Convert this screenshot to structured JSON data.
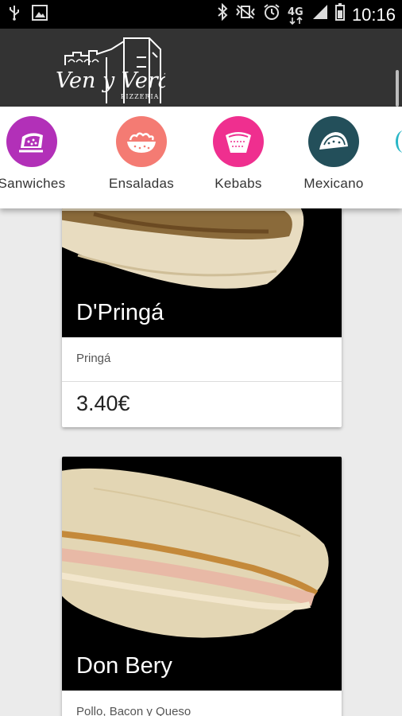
{
  "status_bar": {
    "left_icons": [
      "usb-icon",
      "image-icon"
    ],
    "right_icons": [
      "bluetooth-icon",
      "vibrate-off-icon",
      "alarm-icon",
      "network-4g-icon",
      "signal-icon",
      "battery-icon"
    ],
    "network_label": "4G",
    "time": "10:16"
  },
  "header": {
    "logo_text": "Ven y Verás",
    "logo_subtext": "PIZZERIA"
  },
  "categories": [
    {
      "label": "Sanwiches",
      "color": "#b230b8",
      "icon": "sandwich-icon"
    },
    {
      "label": "Ensaladas",
      "color": "#f47b73",
      "icon": "salad-icon"
    },
    {
      "label": "Kebabs",
      "color": "#ef2f8f",
      "icon": "kebab-icon"
    },
    {
      "label": "Mexicano",
      "color": "#234f5a",
      "icon": "taco-icon"
    }
  ],
  "products": [
    {
      "name": "D'Pringá",
      "description": "Pringá",
      "price": "3.40€"
    },
    {
      "name": "Don Bery",
      "description": "Pollo, Bacon y Queso"
    }
  ]
}
